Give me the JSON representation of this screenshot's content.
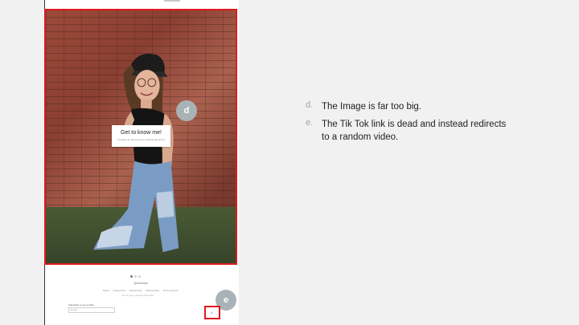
{
  "photo_card": {
    "title": "Get to know me!",
    "subtitle": "A header for the welcome booking adventure"
  },
  "markers": {
    "d": "d",
    "e": "e"
  },
  "footer": {
    "title": "Quick links",
    "links": [
      "Search",
      "Privacy Policy",
      "Refund Policy",
      "Shipping Policy",
      "Terms of Service"
    ],
    "note": "Do not sell my personal information",
    "newsletter_label": "Subscribe to our emails",
    "email_placeholder": "Email",
    "tiktok_icon": "tiktok-icon"
  },
  "notes": [
    {
      "letter": "d.",
      "text": "The Image is far too big."
    },
    {
      "letter": "e.",
      "text": "The Tik Tok link is dead and instead redirects to a random video."
    }
  ],
  "colors": {
    "highlight_border": "#e0191f",
    "marker": "#a9b3b7",
    "note_letter": "#9aa5a8"
  }
}
